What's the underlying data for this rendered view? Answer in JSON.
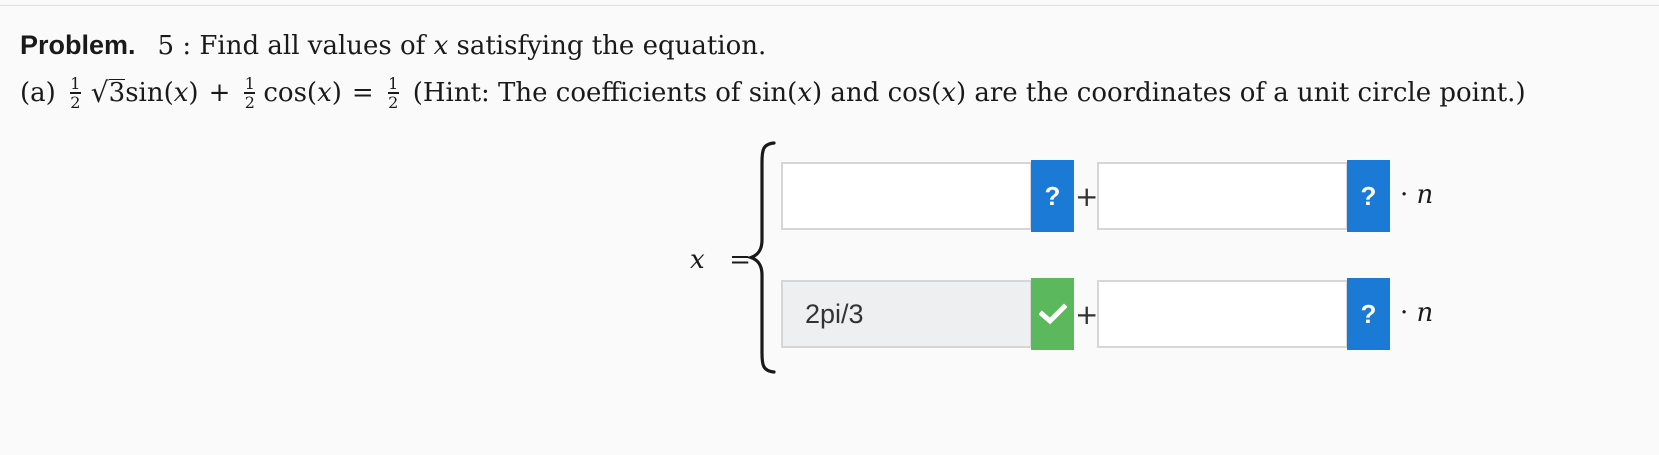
{
  "problem": {
    "label": "Problem.",
    "number": "5",
    "prompt_prefix": " : Find all values of ",
    "variable": "x",
    "prompt_suffix": " satisfying the equation."
  },
  "part_a": {
    "label": "(a)",
    "half": "1",
    "half_den": "2",
    "sqrt_arg": "3",
    "sin_term": "sin(",
    "cos_term": "cos(",
    "close_paren": ")",
    "plus": "+",
    "equals": "=",
    "hint": "(Hint: The coefficients of sin(",
    "hint_mid": ") and cos(",
    "hint_end": ") are the coordinates of a unit circle point.)"
  },
  "solution": {
    "lhs_var": "x",
    "lhs_eq": "=",
    "rows": [
      {
        "base_value": "",
        "base_status": "?",
        "plus": "+",
        "period_value": "",
        "period_status": "?",
        "times": "·",
        "n": "n"
      },
      {
        "base_value": "2pi/3",
        "base_status": "check-icon",
        "plus": "+",
        "period_value": "",
        "period_status": "?",
        "times": "·",
        "n": "n"
      }
    ]
  },
  "colors": {
    "help_button": "#1b7ad6",
    "correct_button": "#5cb85c",
    "answer_box_border": "#d6d6d6",
    "filled_box_bg": "#eeeff1"
  }
}
